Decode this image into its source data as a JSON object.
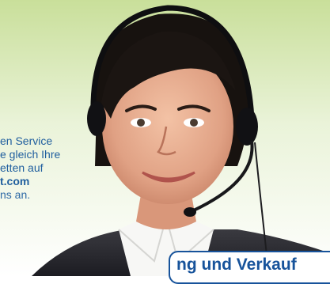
{
  "promo": {
    "line1": "en Service",
    "line2": "e gleich Ihre",
    "line3": "etten auf",
    "line4": "t.com",
    "line5": "ns an."
  },
  "banner": {
    "text": "ng und Verkauf"
  },
  "colors": {
    "brand_blue": "#17539b",
    "text_blue": "#1f5e9e",
    "bg_green": "#d7e8b0"
  }
}
